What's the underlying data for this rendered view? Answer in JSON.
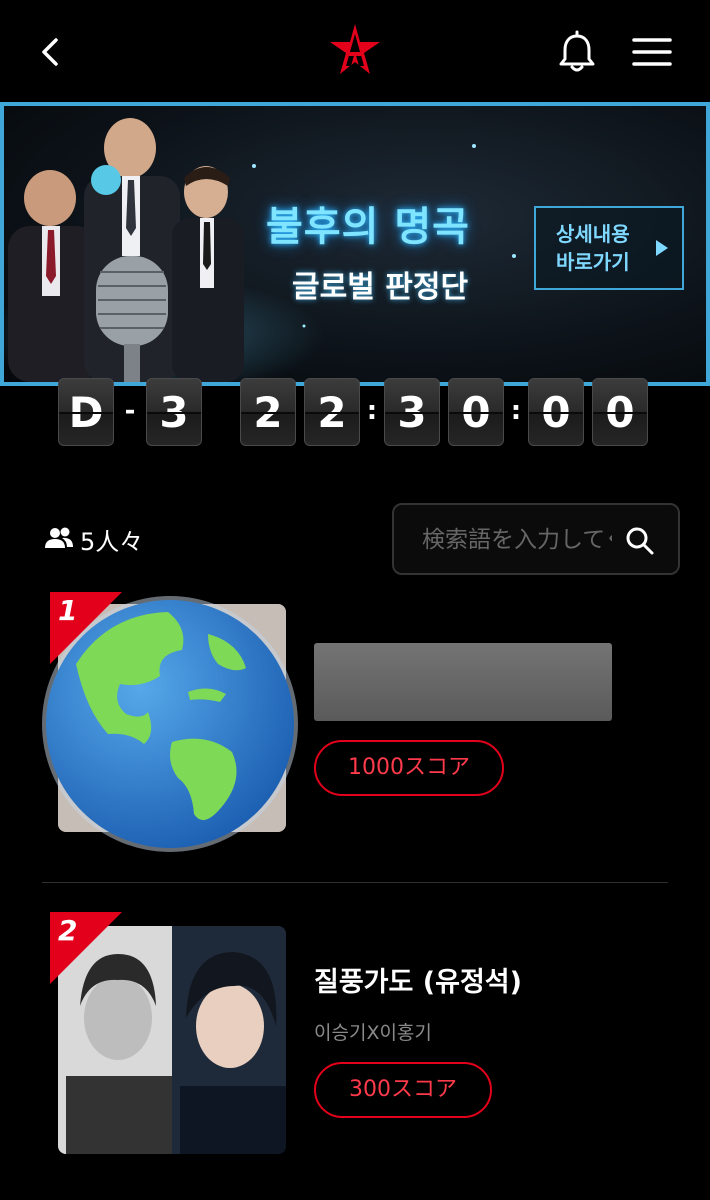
{
  "header": {
    "back_icon": "chevron-left-icon",
    "logo_icon": "star-a-logo",
    "bell_icon": "bell-icon",
    "menu_icon": "hamburger-menu-icon"
  },
  "banner": {
    "title": "불후의 명곡",
    "subtitle": "글로벌 판정단",
    "cta_label": "상세내용\n바로가기",
    "accent_color": "#3fa8d8"
  },
  "countdown": {
    "day_prefix": "D",
    "dash": "-",
    "days": "3",
    "hours": [
      "2",
      "2"
    ],
    "minutes": [
      "3",
      "0"
    ],
    "seconds": [
      "0",
      "0"
    ],
    "colon": ":"
  },
  "participants": {
    "icon": "users-icon",
    "count_label": "5人々"
  },
  "search": {
    "placeholder": "検索語を入力してください",
    "icon": "search-icon"
  },
  "rankings": [
    {
      "rank": "1",
      "score_label": "1000スコア",
      "thumbnail": "globe-emoji-over-photo"
    },
    {
      "rank": "2",
      "title": "질풍가도 (유정석)",
      "artist": "이승기X이홍기",
      "score_label": "300スコア",
      "thumbnail": "two-performers-photo"
    }
  ],
  "colors": {
    "brand_red": "#e3001b",
    "background": "#000000"
  }
}
